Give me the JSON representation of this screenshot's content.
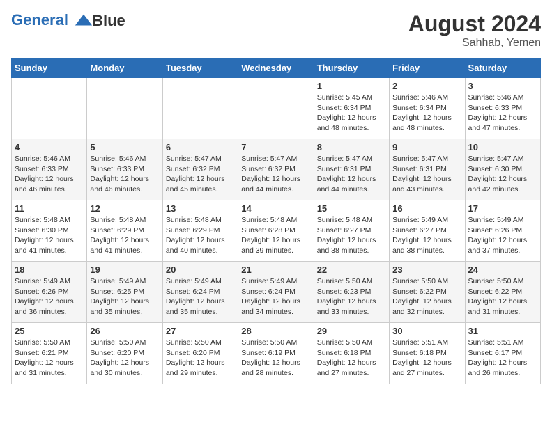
{
  "header": {
    "logo_line1": "General",
    "logo_line2": "Blue",
    "month_year": "August 2024",
    "location": "Sahhab, Yemen"
  },
  "days_of_week": [
    "Sunday",
    "Monday",
    "Tuesday",
    "Wednesday",
    "Thursday",
    "Friday",
    "Saturday"
  ],
  "weeks": [
    [
      {
        "day": "",
        "info": ""
      },
      {
        "day": "",
        "info": ""
      },
      {
        "day": "",
        "info": ""
      },
      {
        "day": "",
        "info": ""
      },
      {
        "day": "1",
        "info": "Sunrise: 5:45 AM\nSunset: 6:34 PM\nDaylight: 12 hours and 48 minutes."
      },
      {
        "day": "2",
        "info": "Sunrise: 5:46 AM\nSunset: 6:34 PM\nDaylight: 12 hours and 48 minutes."
      },
      {
        "day": "3",
        "info": "Sunrise: 5:46 AM\nSunset: 6:33 PM\nDaylight: 12 hours and 47 minutes."
      }
    ],
    [
      {
        "day": "4",
        "info": "Sunrise: 5:46 AM\nSunset: 6:33 PM\nDaylight: 12 hours and 46 minutes."
      },
      {
        "day": "5",
        "info": "Sunrise: 5:46 AM\nSunset: 6:33 PM\nDaylight: 12 hours and 46 minutes."
      },
      {
        "day": "6",
        "info": "Sunrise: 5:47 AM\nSunset: 6:32 PM\nDaylight: 12 hours and 45 minutes."
      },
      {
        "day": "7",
        "info": "Sunrise: 5:47 AM\nSunset: 6:32 PM\nDaylight: 12 hours and 44 minutes."
      },
      {
        "day": "8",
        "info": "Sunrise: 5:47 AM\nSunset: 6:31 PM\nDaylight: 12 hours and 44 minutes."
      },
      {
        "day": "9",
        "info": "Sunrise: 5:47 AM\nSunset: 6:31 PM\nDaylight: 12 hours and 43 minutes."
      },
      {
        "day": "10",
        "info": "Sunrise: 5:47 AM\nSunset: 6:30 PM\nDaylight: 12 hours and 42 minutes."
      }
    ],
    [
      {
        "day": "11",
        "info": "Sunrise: 5:48 AM\nSunset: 6:30 PM\nDaylight: 12 hours and 41 minutes."
      },
      {
        "day": "12",
        "info": "Sunrise: 5:48 AM\nSunset: 6:29 PM\nDaylight: 12 hours and 41 minutes."
      },
      {
        "day": "13",
        "info": "Sunrise: 5:48 AM\nSunset: 6:29 PM\nDaylight: 12 hours and 40 minutes."
      },
      {
        "day": "14",
        "info": "Sunrise: 5:48 AM\nSunset: 6:28 PM\nDaylight: 12 hours and 39 minutes."
      },
      {
        "day": "15",
        "info": "Sunrise: 5:48 AM\nSunset: 6:27 PM\nDaylight: 12 hours and 38 minutes."
      },
      {
        "day": "16",
        "info": "Sunrise: 5:49 AM\nSunset: 6:27 PM\nDaylight: 12 hours and 38 minutes."
      },
      {
        "day": "17",
        "info": "Sunrise: 5:49 AM\nSunset: 6:26 PM\nDaylight: 12 hours and 37 minutes."
      }
    ],
    [
      {
        "day": "18",
        "info": "Sunrise: 5:49 AM\nSunset: 6:26 PM\nDaylight: 12 hours and 36 minutes."
      },
      {
        "day": "19",
        "info": "Sunrise: 5:49 AM\nSunset: 6:25 PM\nDaylight: 12 hours and 35 minutes."
      },
      {
        "day": "20",
        "info": "Sunrise: 5:49 AM\nSunset: 6:24 PM\nDaylight: 12 hours and 35 minutes."
      },
      {
        "day": "21",
        "info": "Sunrise: 5:49 AM\nSunset: 6:24 PM\nDaylight: 12 hours and 34 minutes."
      },
      {
        "day": "22",
        "info": "Sunrise: 5:50 AM\nSunset: 6:23 PM\nDaylight: 12 hours and 33 minutes."
      },
      {
        "day": "23",
        "info": "Sunrise: 5:50 AM\nSunset: 6:22 PM\nDaylight: 12 hours and 32 minutes."
      },
      {
        "day": "24",
        "info": "Sunrise: 5:50 AM\nSunset: 6:22 PM\nDaylight: 12 hours and 31 minutes."
      }
    ],
    [
      {
        "day": "25",
        "info": "Sunrise: 5:50 AM\nSunset: 6:21 PM\nDaylight: 12 hours and 31 minutes."
      },
      {
        "day": "26",
        "info": "Sunrise: 5:50 AM\nSunset: 6:20 PM\nDaylight: 12 hours and 30 minutes."
      },
      {
        "day": "27",
        "info": "Sunrise: 5:50 AM\nSunset: 6:20 PM\nDaylight: 12 hours and 29 minutes."
      },
      {
        "day": "28",
        "info": "Sunrise: 5:50 AM\nSunset: 6:19 PM\nDaylight: 12 hours and 28 minutes."
      },
      {
        "day": "29",
        "info": "Sunrise: 5:50 AM\nSunset: 6:18 PM\nDaylight: 12 hours and 27 minutes."
      },
      {
        "day": "30",
        "info": "Sunrise: 5:51 AM\nSunset: 6:18 PM\nDaylight: 12 hours and 27 minutes."
      },
      {
        "day": "31",
        "info": "Sunrise: 5:51 AM\nSunset: 6:17 PM\nDaylight: 12 hours and 26 minutes."
      }
    ]
  ]
}
